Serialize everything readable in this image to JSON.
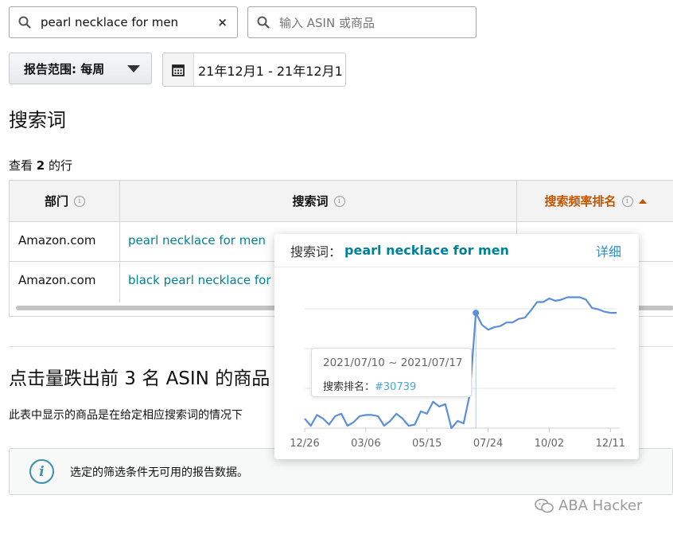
{
  "search": {
    "term_value": "pearl necklace for men",
    "asin_placeholder": "输入 ASIN 或商品"
  },
  "report": {
    "range_label": "报告范围: 每周",
    "date_value": "21年12月1 - 21年12月1"
  },
  "search_terms": {
    "title": "搜索词",
    "rows_prefix": "查看 ",
    "rows_count": "2",
    "rows_suffix": " 的行",
    "columns": [
      "部门",
      "搜索词",
      "搜索频率排名"
    ],
    "rows": [
      {
        "department": "Amazon.com",
        "term": "pearl necklace for men"
      },
      {
        "department": "Amazon.com",
        "term": "black pearl necklace for men"
      }
    ]
  },
  "asin_section": {
    "title": "点击量跌出前 3 名 ASIN 的商品",
    "description": "此表中显示的商品是在给定相应搜索词的情况下",
    "alert_text": "选定的筛选条件无可用的报告数据。"
  },
  "popover": {
    "label": "搜索词：",
    "term": "pearl necklace for men",
    "details_link": "详细",
    "tooltip": {
      "date_range": "2021/07/10 ~ 2021/07/17",
      "rank_label": "搜索排名：",
      "rank_value": "#30739"
    }
  },
  "chart_data": {
    "type": "line",
    "x_tick_labels": [
      "12/26",
      "03/06",
      "05/15",
      "07/24",
      "10/02",
      "12/11"
    ],
    "x": [
      "2020-12-26",
      "2021-01-02",
      "2021-01-09",
      "2021-01-16",
      "2021-01-23",
      "2021-01-30",
      "2021-02-06",
      "2021-02-13",
      "2021-02-20",
      "2021-02-27",
      "2021-03-06",
      "2021-03-13",
      "2021-03-20",
      "2021-03-27",
      "2021-04-03",
      "2021-04-10",
      "2021-04-17",
      "2021-04-24",
      "2021-05-01",
      "2021-05-08",
      "2021-05-15",
      "2021-05-22",
      "2021-05-29",
      "2021-06-05",
      "2021-06-12",
      "2021-06-19",
      "2021-06-26",
      "2021-07-03",
      "2021-07-10",
      "2021-07-17",
      "2021-07-24",
      "2021-07-31",
      "2021-08-07",
      "2021-08-14",
      "2021-08-21",
      "2021-08-28",
      "2021-09-04",
      "2021-09-11",
      "2021-09-18",
      "2021-09-25",
      "2021-10-02",
      "2021-10-09",
      "2021-10-16",
      "2021-10-23",
      "2021-10-30",
      "2021-11-06",
      "2021-11-13",
      "2021-11-20",
      "2021-11-27",
      "2021-12-04",
      "2021-12-11",
      "2021-12-18"
    ],
    "series": [
      {
        "values": [
          0.08,
          0.02,
          0.11,
          0.08,
          0.03,
          0.1,
          0.12,
          0.02,
          0.05,
          0.1,
          0.11,
          0.11,
          0.1,
          0.02,
          0.06,
          0.12,
          0.08,
          0.02,
          0.03,
          0.14,
          0.12,
          0.22,
          0.18,
          0.2,
          0.0,
          0.06,
          0.04,
          0.28,
          0.96,
          0.86,
          0.82,
          0.84,
          0.85,
          0.88,
          0.88,
          0.91,
          0.92,
          0.98,
          1.05,
          1.05,
          1.08,
          1.06,
          1.07,
          1.09,
          1.09,
          1.09,
          1.07,
          1.0,
          0.99,
          0.97,
          0.96,
          0.96
        ]
      }
    ],
    "highlight_index": 28,
    "grid": true
  }
}
